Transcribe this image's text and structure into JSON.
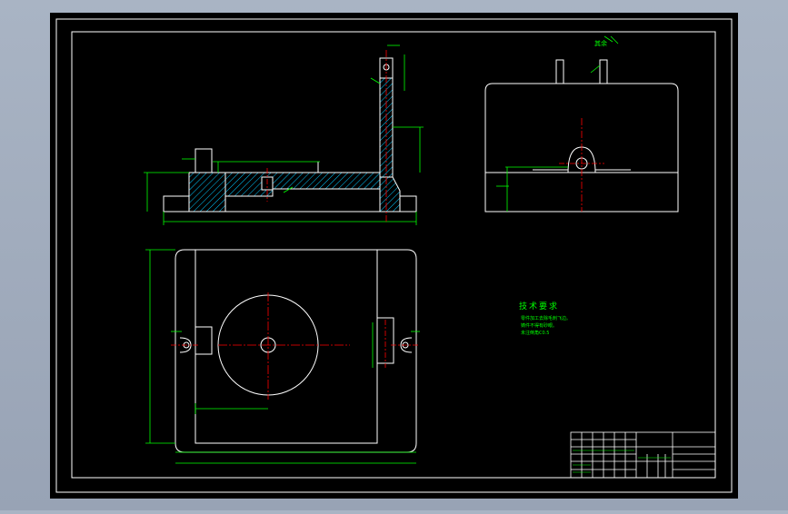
{
  "drawing": {
    "tech_title": "技术要求",
    "tech_lines": [
      "零件加工去除毛刺飞边。",
      "铸件不得有砂眼。",
      "未注倒角C0.5"
    ],
    "roughness_label": "其余"
  },
  "colors": {
    "background": "#000000",
    "frame": "#ffffff",
    "dimension": "#00ff00",
    "centerline": "#ff0000",
    "outline": "#ffffff",
    "hatch": "#00c8ff"
  }
}
